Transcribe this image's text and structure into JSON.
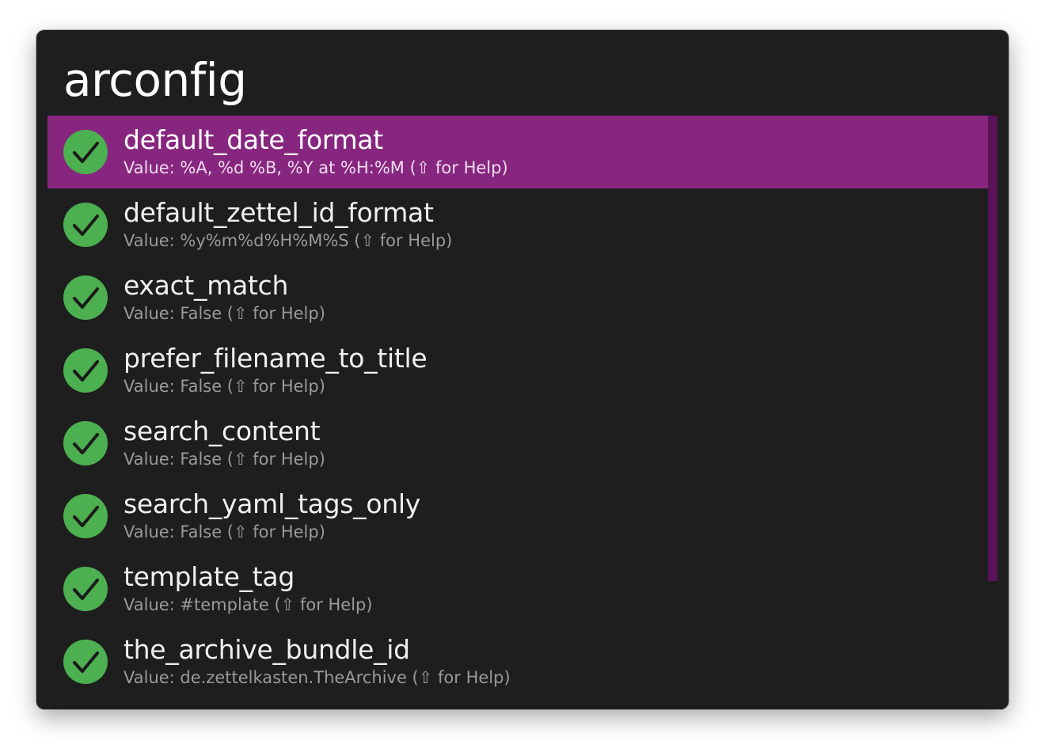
{
  "search": {
    "query": "arconfig"
  },
  "colors": {
    "window_bg": "#1e1e1e",
    "selection": "#87267f",
    "check_green": "#4caf50",
    "scrollbar": "#5b1257"
  },
  "results": [
    {
      "title": "default_date_format",
      "subtitle": "Value: %A, %d %B, %Y at %H:%M (⇧ for Help)",
      "icon": "checkmark-circle-icon",
      "selected": true
    },
    {
      "title": "default_zettel_id_format",
      "subtitle": "Value: %y%m%d%H%M%S (⇧ for Help)",
      "icon": "checkmark-circle-icon",
      "selected": false
    },
    {
      "title": "exact_match",
      "subtitle": "Value: False (⇧ for Help)",
      "icon": "checkmark-circle-icon",
      "selected": false
    },
    {
      "title": "prefer_filename_to_title",
      "subtitle": "Value: False (⇧ for Help)",
      "icon": "checkmark-circle-icon",
      "selected": false
    },
    {
      "title": "search_content",
      "subtitle": "Value: False (⇧ for Help)",
      "icon": "checkmark-circle-icon",
      "selected": false
    },
    {
      "title": "search_yaml_tags_only",
      "subtitle": "Value: False (⇧ for Help)",
      "icon": "checkmark-circle-icon",
      "selected": false
    },
    {
      "title": "template_tag",
      "subtitle": "Value: #template (⇧ for Help)",
      "icon": "checkmark-circle-icon",
      "selected": false
    },
    {
      "title": "the_archive_bundle_id",
      "subtitle": "Value: de.zettelkasten.TheArchive (⇧ for Help)",
      "icon": "checkmark-circle-icon",
      "selected": false
    }
  ]
}
